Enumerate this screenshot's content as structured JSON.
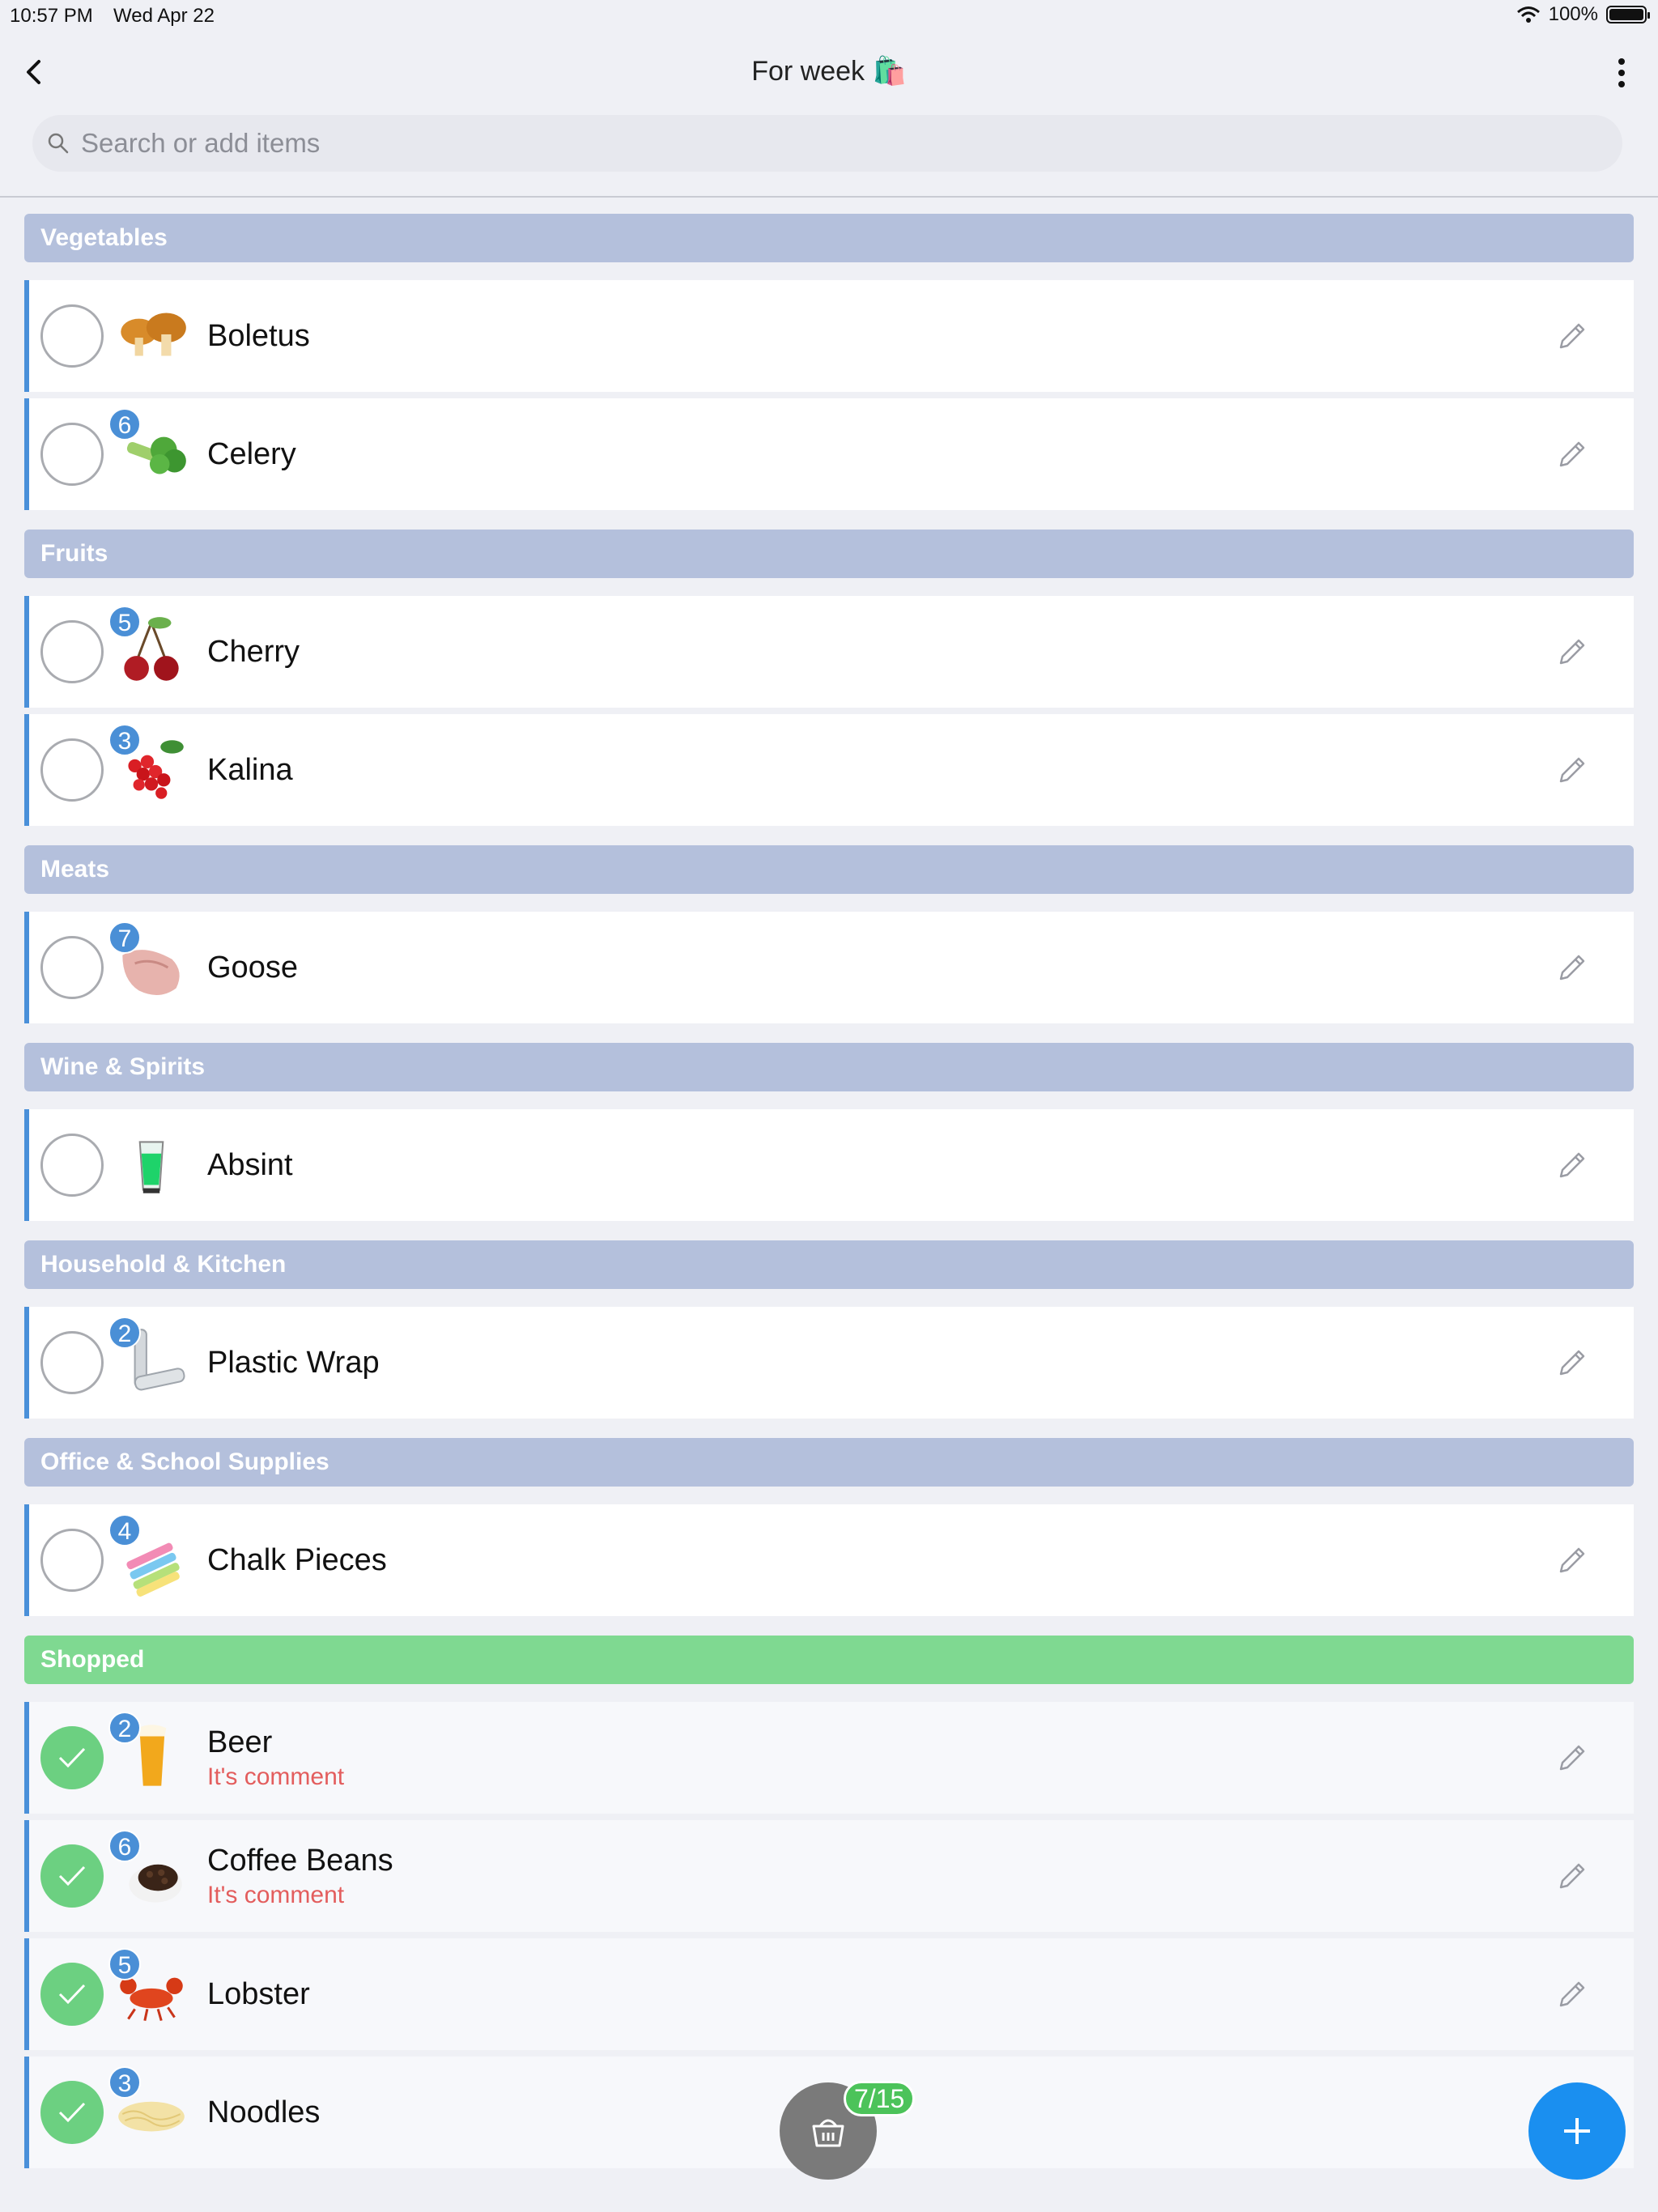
{
  "status_bar": {
    "time": "10:57 PM",
    "date": "Wed Apr 22",
    "battery": "100%"
  },
  "header": {
    "title": "For week 🛍️",
    "search_placeholder": "Search or add items"
  },
  "sections": [
    {
      "name": "Vegetables",
      "items": [
        {
          "name": "Boletus",
          "qty": "",
          "icon": "mushroom-icon"
        },
        {
          "name": "Celery",
          "qty": "6",
          "icon": "celery-icon"
        }
      ]
    },
    {
      "name": "Fruits",
      "items": [
        {
          "name": "Cherry",
          "qty": "5",
          "icon": "cherry-icon"
        },
        {
          "name": "Kalina",
          "qty": "3",
          "icon": "berries-icon"
        }
      ]
    },
    {
      "name": "Meats",
      "items": [
        {
          "name": "Goose",
          "qty": "7",
          "icon": "goose-meat-icon"
        }
      ]
    },
    {
      "name": "Wine & Spirits",
      "items": [
        {
          "name": "Absint",
          "qty": "",
          "icon": "glass-icon"
        }
      ]
    },
    {
      "name": "Household & Kitchen",
      "items": [
        {
          "name": "Plastic Wrap",
          "qty": "2",
          "icon": "plastic-wrap-icon"
        }
      ]
    },
    {
      "name": "Office & School Supplies",
      "items": [
        {
          "name": "Chalk Pieces",
          "qty": "4",
          "icon": "chalk-icon"
        }
      ]
    }
  ],
  "shopped": {
    "name": "Shopped",
    "items": [
      {
        "name": "Beer",
        "qty": "2",
        "comment": "It's comment",
        "icon": "beer-icon"
      },
      {
        "name": "Coffee Beans",
        "qty": "6",
        "comment": "It's comment",
        "icon": "coffee-beans-icon"
      },
      {
        "name": "Lobster",
        "qty": "5",
        "comment": "",
        "icon": "lobster-icon"
      },
      {
        "name": "Noodles",
        "qty": "3",
        "comment": "",
        "icon": "noodles-icon"
      }
    ]
  },
  "footer": {
    "progress": "7/15"
  },
  "colors": {
    "accent": "#1a8ff0",
    "category": "#b4c0dc",
    "shopped": "#7fd991",
    "badge": "#4a8fd6",
    "comment": "#e35d5d"
  }
}
